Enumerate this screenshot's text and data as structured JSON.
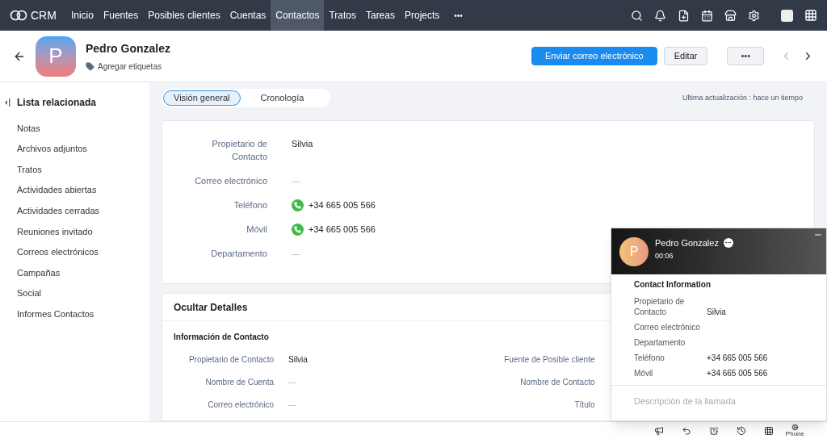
{
  "nav": {
    "brand": "CRM",
    "items": [
      {
        "label": "Inicio",
        "selected": false
      },
      {
        "label": "Fuentes",
        "selected": false
      },
      {
        "label": "Posibles clientes",
        "selected": false
      },
      {
        "label": "Cuentas",
        "selected": false
      },
      {
        "label": "Contactos",
        "selected": true
      },
      {
        "label": "Tratos",
        "selected": false
      },
      {
        "label": "Tareas",
        "selected": false
      },
      {
        "label": "Projects",
        "selected": false
      }
    ],
    "more": "•••"
  },
  "header": {
    "initial": "P",
    "name": "Pedro Gonzalez",
    "tags": "Agregar etiquetas",
    "buttons": [
      {
        "kind": "primary",
        "label": "Enviar correo electrónico"
      },
      {
        "kind": "secondary",
        "label": "Editar"
      },
      {
        "kind": "more",
        "label": "•••"
      }
    ]
  },
  "sidebar": {
    "title": "Lista relacionada",
    "items": [
      "Notas",
      "Archivos adjuntos",
      "Tratos",
      "Actividades abiertas",
      "Actividades cerradas",
      "Reuniones invitado",
      "Correos electrónicos",
      "Campañas",
      "Social",
      "Informes Contactos"
    ]
  },
  "tabs": [
    {
      "label": "Visión general",
      "selected": true
    },
    {
      "label": "Cronología",
      "selected": false
    }
  ],
  "last_updated": "Ultima actualización : hace un tiempo",
  "overview": [
    {
      "label": "Propietario de Contacto",
      "value": "Silvia",
      "phone": false
    },
    {
      "label": "Correo electrónico",
      "value": "—",
      "phone": false
    },
    {
      "label": "Teléfono",
      "value": "+34 665 005 566",
      "phone": true
    },
    {
      "label": "Móvil",
      "value": "+34 665 005 566",
      "phone": true
    },
    {
      "label": "Departamento",
      "value": "—",
      "phone": false
    }
  ],
  "details": {
    "title": "Ocultar Detalles",
    "section": "Información de Contacto",
    "left": [
      {
        "label": "Propietario de Contacto",
        "value": "Silvia"
      },
      {
        "label": "Nombre de Cuenta",
        "value": "—"
      },
      {
        "label": "Correo electrónico",
        "value": "—"
      }
    ],
    "right": [
      "Fuente de Posible cliente",
      "Nombre de Contacto",
      "Título"
    ]
  },
  "call": {
    "initial": "P",
    "name": "Pedro Gonzalez",
    "duration": "00:06",
    "section": "Contact Information",
    "fields": [
      {
        "label": "Propietario de Contacto",
        "value": "Silvia"
      },
      {
        "label": "Correo electrónico"
      },
      {
        "label": "Departamento"
      },
      {
        "label": "Teléfono",
        "value": "+34 665 005 566"
      },
      {
        "label": "Móvil",
        "value": "+34 665 005 566"
      }
    ],
    "description_placeholder": "Descripción de la llamada"
  },
  "bottom_bar": {
    "phone_label": "Phone"
  }
}
